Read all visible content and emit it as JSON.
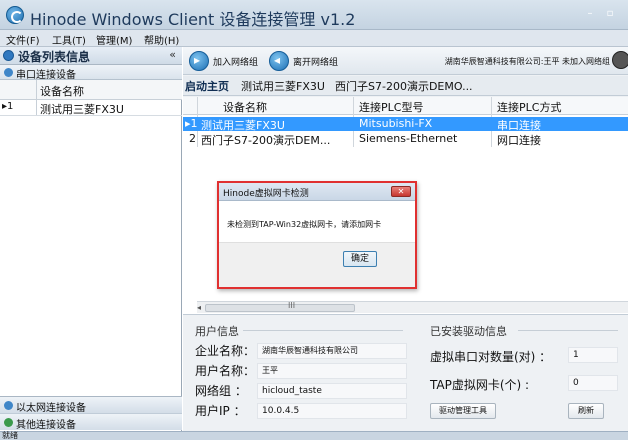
{
  "window": {
    "title": "Hinode Windows Client 设备连接管理 v1.2",
    "min_glyph": "–",
    "max_glyph": "▫"
  },
  "menu": [
    "文件(F)",
    "工具(T)",
    "管理(M)",
    "帮助(H)"
  ],
  "sidebar": {
    "title": "设备列表信息",
    "collapse_glyph": "«",
    "section_serial": "串口连接设备",
    "column": "设备名称",
    "rows": [
      {
        "marker": "▸1",
        "name": "测试用三菱FX3U"
      }
    ],
    "section_ethernet": "以太网连接设备",
    "section_other": "其他连接设备"
  },
  "toolbar": {
    "join_label": "加入网络组",
    "leave_label": "离开网络组",
    "user_text": "湖南华辰智通科技有限公司:王平  未加入网络组"
  },
  "tabs": [
    "启动主页",
    "测试用三菱FX3U",
    "西门子S7-200演示DEMO..."
  ],
  "grid": {
    "headers": [
      "设备名称",
      "连接PLC型号",
      "连接PLC方式"
    ],
    "rows": [
      {
        "no": "▸1",
        "name": "测试用三菱FX3U",
        "model": "Mitsubishi-FX",
        "mode": "串口连接"
      },
      {
        "no": "2",
        "name": "西门子S7-200演示DEM...",
        "model": "Siemens-Ethernet",
        "mode": "网口连接"
      }
    ],
    "scroll_grip": "III",
    "scroll_arrow": "◂"
  },
  "dialog": {
    "title": "Hinode虚拟网卡检测",
    "close_glyph": "✕",
    "message": "未检测到TAP-Win32虚拟网卡，请添加网卡",
    "ok": "确定"
  },
  "user_info": {
    "title": "用户信息",
    "company_label": "企业名称：",
    "company_value": "湖南华辰智通科技有限公司",
    "username_label": "用户名称：",
    "username_value": "王平",
    "group_label": "网络组 ：",
    "group_value": "hicloud_taste",
    "ip_label": "用户IP ：",
    "ip_value": "10.0.4.5"
  },
  "driver_info": {
    "title": "已安装驱动信息",
    "serial_pairs_label": "虚拟串口对数量(对) ：",
    "serial_pairs_value": "1",
    "tap_label": "TAP虚拟网卡(个) :",
    "tap_value": "0",
    "driver_tool_button": "驱动管理工具",
    "refresh_button": "刷新"
  },
  "status": "就绪"
}
